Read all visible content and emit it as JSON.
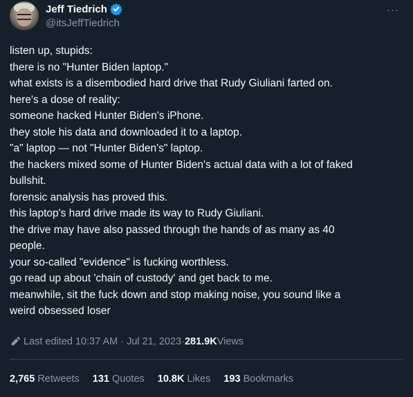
{
  "author": {
    "display_name": "Jeff Tiedrich",
    "handle": "@itsJeffTiedrich",
    "verified": true
  },
  "more_label": "···",
  "tweet_lines": [
    "listen up, stupids:",
    "there is no \"Hunter Biden laptop.\"",
    "what exists is a disembodied hard drive that Rudy Giuliani farted on.",
    "here's a dose of reality:",
    "someone hacked Hunter Biden's iPhone.",
    "they stole his data and downloaded it to a laptop.",
    "\"a\" laptop — not \"Hunter Biden's\" laptop.",
    "the hackers mixed some of Hunter Biden's actual data with a lot of faked",
    "bullshit.",
    "forensic analysis has proved this.",
    "this laptop's hard drive made its way to Rudy Giuliani.",
    "the drive may have also passed through the hands of as many as 40",
    "people.",
    "your so-called \"evidence\" is fucking worthless.",
    "go read up about 'chain of custody' and get back to me.",
    "meanwhile, sit the fuck down and stop making noise, you sound like a",
    "weird obsessed loser"
  ],
  "meta": {
    "edited_label": "Last edited 10:37 AM · Jul 21, 2023",
    "separator": " · ",
    "views_count": "281.9K",
    "views_label": " Views"
  },
  "stats": [
    {
      "count": "2,765",
      "label": " Retweets"
    },
    {
      "count": "131",
      "label": " Quotes"
    },
    {
      "count": "10.8K",
      "label": " Likes"
    },
    {
      "count": "193",
      "label": " Bookmarks"
    }
  ],
  "colors": {
    "background": "#15202b",
    "text": "#f7f9f9",
    "secondary": "#8b98a5",
    "verified": "#1d9bf0",
    "divider": "#38444d"
  }
}
